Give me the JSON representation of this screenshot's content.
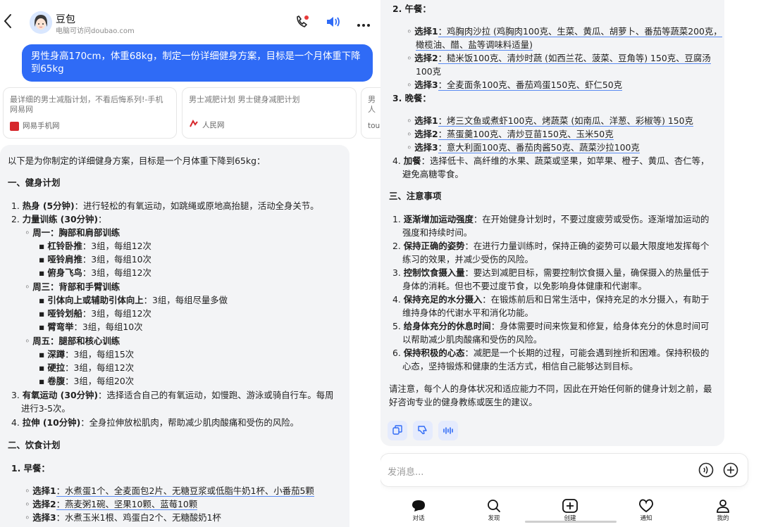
{
  "header": {
    "name": "豆包",
    "subtitle": "电脑可访问doubao.com"
  },
  "user_message": "男性身高170cm，体重68kg，制定一份详细健身方案，目标是一个月体重下降到65kg",
  "references": [
    {
      "title": "最详细的男士减脂计划，不看后悔系列!-手机网易网",
      "source": "网易手机网"
    },
    {
      "title": "男士减肥计划 男士健身减肥计划",
      "source": "人民网"
    },
    {
      "title": "男人",
      "source": "tou"
    }
  ],
  "answer": {
    "intro": "以下是为你制定的详细健身方案，目标是一个月体重下降到65kg：",
    "s1": "一、健身计划",
    "f1_num": "1.",
    "f1_b": "热身 (5分钟)",
    "f1_t": "：进行轻松的有氧运动，如跳绳或原地高抬腿，活动全身关节。",
    "f2_num": "2.",
    "f2_b": "力量训练 (30分钟)",
    "f2_t": "：",
    "d1": "周一：胸部和肩部训练",
    "d1a_b": "杠铃卧推",
    "d1a_t": "：3组，每组12次",
    "d1b_b": "哑铃肩推",
    "d1b_t": "：3组，每组10次",
    "d1c_b": "俯身飞鸟",
    "d1c_t": "：3组，每组12次",
    "d2": "周三：背部和手臂训练",
    "d2a_b": "引体向上或辅助引体向上",
    "d2a_t": "：3组，每组尽量多做",
    "d2b_b": "哑铃划船",
    "d2b_t": "：3组，每组12次",
    "d2c_b": "臂弯举",
    "d2c_t": "：3组，每组10次",
    "d3": "周五：腿部和核心训练",
    "d3a_b": "深蹲",
    "d3a_t": "：3组，每组15次",
    "d3b_b": "硬拉",
    "d3b_t": "：3组，每组12次",
    "d3c_b": "卷腹",
    "d3c_t": "：3组，每组20次",
    "f3_num": "3.",
    "f3_b": "有氧运动 (30分钟)",
    "f3_t1": "：选择适合自己的有氧运动，如慢跑、游泳或骑自行车。每周",
    "f3_t2": "进行3-5次。",
    "f4_num": "4.",
    "f4_b": "拉伸 (10分钟)",
    "f4_t": "：全身拉伸放松肌肉，帮助减少肌肉酸痛和受伤的风险。",
    "s2": "二、饮食计划",
    "m1": "1. 早餐：",
    "b1_b": "选择1",
    "b1_t": "：水煮蛋1个、全麦面包2片、无糖豆浆或低脂牛奶1杯、小番茄5颗",
    "b2_b": "选择2",
    "b2_t": "：燕麦粥1碗、坚果10颗、蓝莓10颗",
    "b3_b": "选择3",
    "b3_t": "：水煮玉米1根、鸡蛋白2个、无糖酸奶1杯",
    "m2": "2. 午餐：",
    "l1_b": "选择1",
    "l1_t1": "：鸡胸肉沙拉 (鸡胸肉100克、生菜、黄瓜、胡萝卜、番茄等蔬菜200克，",
    "l1_t2": "橄榄油、醋、盐等调味料适量)",
    "l2_b": "选择2",
    "l2_t1": "：糙米饭100克、清炒时蔬 (如西兰花、菠菜、豆角等) 150克、豆腐汤",
    "l2_t2": "100克",
    "l3_b": "选择3",
    "l3_t": "：全麦面条100克、番茄鸡蛋150克、虾仁50克",
    "m3": "3. 晚餐：",
    "n1_b": "选择1",
    "n1_t": "：烤三文鱼或煮虾100克、烤蔬菜 (如南瓜、洋葱、彩椒等) 150克",
    "n2_b": "选择2",
    "n2_t": "：蒸蛋羹100克、清炒豆苗150克、玉米50克",
    "n3_b": "选择3",
    "n3_t": "：意大利面100克、番茄肉酱50克、蔬菜沙拉100克",
    "m4_num": "4.",
    "m4_b": "加餐",
    "m4_t1": "：选择低卡、高纤维的水果、蔬菜或坚果，如苹果、橙子、黄瓜、杏仁等，",
    "m4_t2": "避免高糖零食。",
    "s3": "三、注意事项",
    "n_1_num": "1.",
    "n_1_b": "逐渐增加运动强度",
    "n_1_t1": "：在开始健身计划时，不要过度疲劳或受伤。逐渐增加运动的",
    "n_1_t2": "强度和持续时间。",
    "n_2_num": "2.",
    "n_2_b": "保持正确的姿势",
    "n_2_t1": "：在进行力量训练时，保持正确的姿势可以最大限度地发挥每个",
    "n_2_t2": "练习的效果，并减少受伤的风险。",
    "n_3_num": "3.",
    "n_3_b": "控制饮食摄入量",
    "n_3_t1": "：要达到减肥目标，需要控制饮食摄入量，确保摄入的热量低于",
    "n_3_t2": "身体的消耗。但也不要过度节食，以免影响身体健康和代谢率。",
    "n_4_num": "4.",
    "n_4_b": "保持充足的水分摄入",
    "n_4_t1": "：在锻炼前后和日常生活中，保持充足的水分摄入，有助于",
    "n_4_t2": "维持身体的代谢水平和消化功能。",
    "n_5_num": "5.",
    "n_5_b": "给身体充分的休息时间",
    "n_5_t1": "：身体需要时间来恢复和修复，给身体充分的休息时间可",
    "n_5_t2": "以帮助减少肌肉酸痛和受伤的风险。",
    "n_6_num": "6.",
    "n_6_b": "保持积极的心态",
    "n_6_t1": "：减肥是一个长期的过程，可能会遇到挫折和困难。保持积极的",
    "n_6_t2": "心态，坚持锻炼和健康的生活方式，相信自己能够达到目标。",
    "closing1": "请注意，每个人的身体状况和适应能力不同，因此在开始任何新的健身计划之前，最",
    "closing2": "好咨询专业的健身教练或医生的建议。"
  },
  "composer": {
    "placeholder": "发消息..."
  },
  "tabs": [
    {
      "label": "对话"
    },
    {
      "label": "发现"
    },
    {
      "label": "创建"
    },
    {
      "label": "通知"
    },
    {
      "label": "我的"
    }
  ],
  "colors": {
    "accent": "#2f6bf6",
    "bubble_gray": "#f3f4f6",
    "link_underline": "#5a8bf2"
  }
}
